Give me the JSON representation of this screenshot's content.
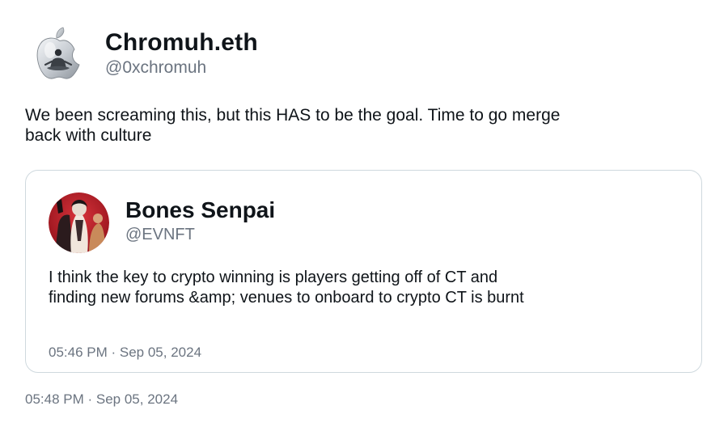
{
  "tweet": {
    "author": {
      "display_name": "Chromuh.eth",
      "handle": "@0xchromuh",
      "avatar_icon": "apple-logo-meditating-figure"
    },
    "text_line1": "We been screaming this, but this HAS to be the goal. Time to go merge",
    "text_line2": "back with culture",
    "timestamp": "05:48 PM · Sep 05, 2024"
  },
  "quote": {
    "author": {
      "display_name": "Bones Senpai",
      "handle": "@EVNFT",
      "avatar_icon": "red-illustrated-portrait"
    },
    "text_line1": "I think the key to crypto winning is players getting off of CT and",
    "text_line2": "finding new forums &amp; venues to onboard to crypto CT is burnt",
    "timestamp": "05:46 PM · Sep 05, 2024"
  },
  "colors": {
    "text_primary": "#0f1419",
    "text_secondary": "#6b7480",
    "border": "#cfd9de",
    "quote_avatar_bg": "#b01a24"
  }
}
